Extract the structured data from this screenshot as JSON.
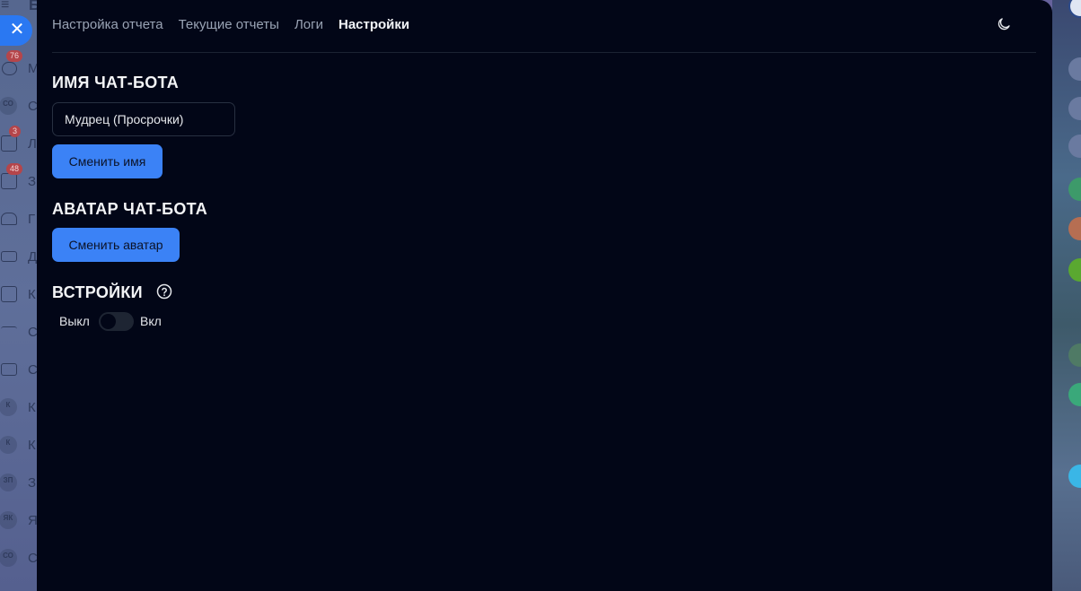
{
  "background_app": {
    "top_letter": "Б",
    "sidebar": [
      {
        "letter": "М",
        "badge": "76",
        "icon": "chat-icon"
      },
      {
        "letter": "С",
        "avatar": "СО"
      },
      {
        "letter": "Л",
        "badge": "3",
        "icon": "feed-icon"
      },
      {
        "letter": "З",
        "badge": "48",
        "icon": "tasks-icon"
      },
      {
        "letter": "Г",
        "icon": "groups-icon"
      },
      {
        "letter": "Д",
        "icon": "drive-icon"
      },
      {
        "letter": "К",
        "icon": "calendar-icon"
      },
      {
        "letter": "С",
        "icon": "filter-icon"
      },
      {
        "letter": "С",
        "icon": "cards-icon"
      },
      {
        "letter": "К",
        "avatar": "К"
      },
      {
        "letter": "К",
        "avatar": "К"
      },
      {
        "letter": "З",
        "avatar": "ЗП"
      },
      {
        "letter": "Я",
        "avatar": "ЯК"
      },
      {
        "letter": "С",
        "avatar": "СО"
      }
    ]
  },
  "tabs": [
    {
      "label": "Настройка отчета",
      "active": false
    },
    {
      "label": "Текущие отчеты",
      "active": false
    },
    {
      "label": "Логи",
      "active": false
    },
    {
      "label": "Настройки",
      "active": true
    }
  ],
  "name_section": {
    "title": "ИМЯ ЧАТ-БОТА",
    "input_value": "Мудрец (Просрочки)",
    "button_label": "Сменить имя"
  },
  "avatar_section": {
    "title": "АВАТАР ЧАТ-БОТА",
    "button_label": "Сменить аватар"
  },
  "embeds_section": {
    "title": "ВСТРОЙКИ",
    "off_label": "Выкл",
    "on_label": "Вкл",
    "enabled": false
  },
  "colors": {
    "panel_bg": "#020617",
    "accent": "#3b82f6",
    "close_button": "#2a78f2"
  }
}
